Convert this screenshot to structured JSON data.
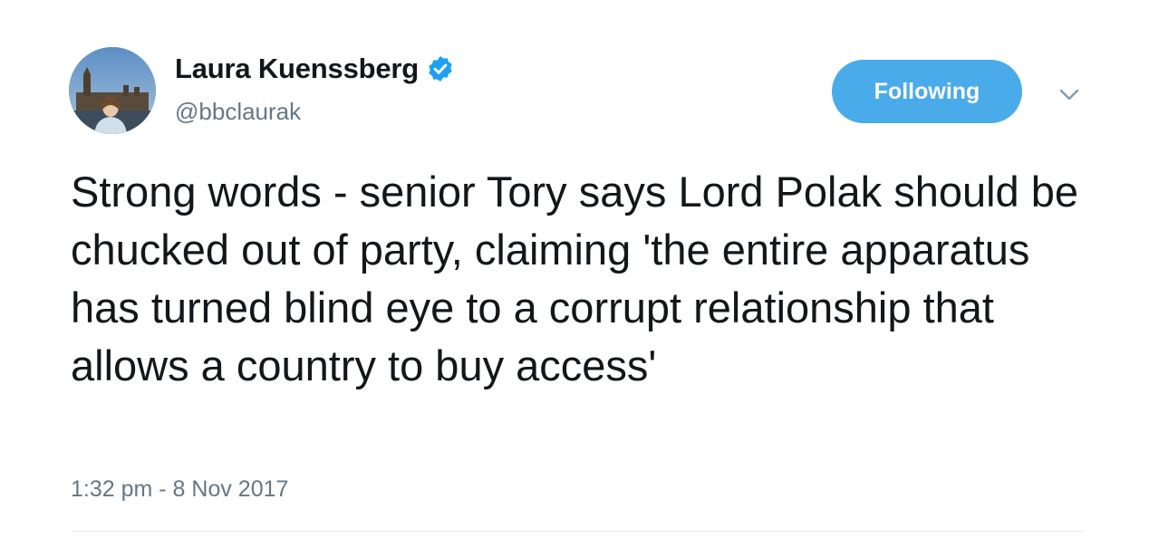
{
  "tweet": {
    "author": {
      "name": "Laura Kuenssberg",
      "handle": "@bbclaurak",
      "verified": true
    },
    "follow_button_label": "Following",
    "menu_icon": "chevron-down-icon",
    "text": "Strong words - senior Tory says Lord Polak should be chucked out of party, claiming 'the entire apparatus has turned blind eye to a corrupt relationship that allows a country to buy access'",
    "timestamp": "1:32 pm - 8 Nov 2017"
  },
  "colors": {
    "accent": "#4aabea",
    "verified_badge": "#1da1f2",
    "secondary_text": "#657786",
    "primary_text": "#14171a"
  }
}
